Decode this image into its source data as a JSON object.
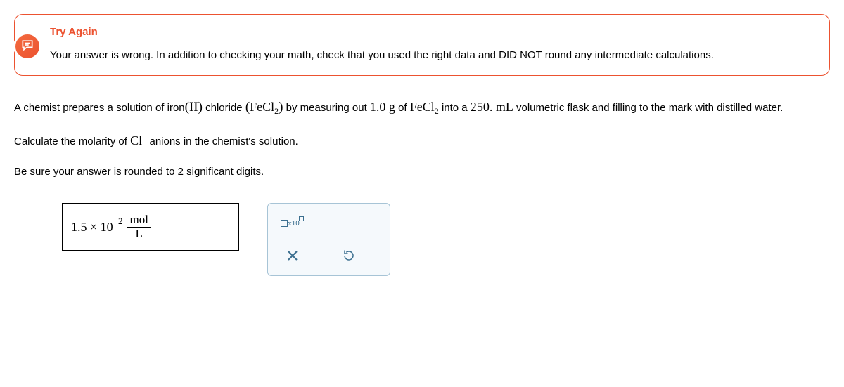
{
  "feedback": {
    "title": "Try Again",
    "message": "Your answer is wrong. In addition to checking your math, check that you used the right data and DID NOT round any intermediate calculations."
  },
  "question": {
    "p1_a": "A chemist prepares a solution of iron",
    "p1_roman": "(II)",
    "p1_b": " chloride ",
    "formula1_open": "(",
    "formula1_body": "FeCl",
    "formula1_sub": "2",
    "formula1_close": ")",
    "p1_c": " by measuring out ",
    "mass": "1.0",
    "mass_unit": " g",
    "p1_d": " of ",
    "formula2_body": "FeCl",
    "formula2_sub": "2",
    "p1_e": " into a ",
    "vol": "250.",
    "vol_unit": " mL",
    "p1_f": " volumetric flask and filling to the mark with distilled water.",
    "p2_a": "Calculate the molarity of ",
    "anion": "Cl",
    "anion_charge": "−",
    "p2_b": " anions in the chemist's solution.",
    "p3": "Be sure your answer is rounded to 2 significant digits."
  },
  "answer": {
    "coef": "1.5 × 10",
    "exp": "−2",
    "unit_num": "mol",
    "unit_den": "L"
  },
  "tools": {
    "sci_label": "x10"
  }
}
